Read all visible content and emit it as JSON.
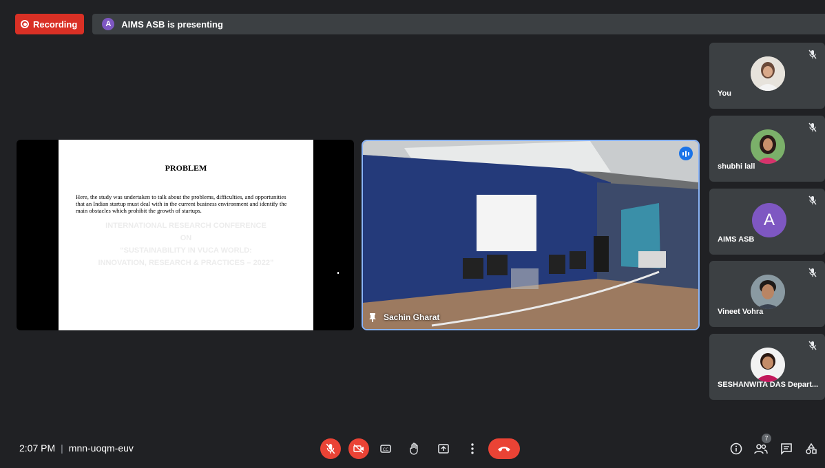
{
  "recording": {
    "label": "Recording"
  },
  "presentation_banner": {
    "avatar_letter": "A",
    "text": "AIMS ASB is presenting"
  },
  "slide": {
    "title": "PROBLEM",
    "body": "Here, the study was undertaken to talk about the problems, difficulties, and opportunities that an Indian startup must deal with in the current business environment and identify the main obstacles which prohibit the growth of startups.",
    "watermark": [
      "INTERNATIONAL RESEARCH CONFERENCE",
      "ON",
      "“SUSTAINABILITY IN VUCA WORLD:",
      "INNOVATION, RESEARCH & PRACTICES – 2022”"
    ]
  },
  "active_speaker": {
    "name": "Sachin Gharat"
  },
  "participants": [
    {
      "name": "You",
      "avatar": "photo",
      "muted": true
    },
    {
      "name": "shubhi lall",
      "avatar": "photo",
      "muted": true
    },
    {
      "name": "AIMS ASB",
      "avatar_letter": "A",
      "muted": true
    },
    {
      "name": "Vineet Vohra",
      "avatar": "photo",
      "muted": true
    },
    {
      "name": "SESHANWITA DAS Depart...",
      "avatar": "photo",
      "muted": true
    }
  ],
  "meeting": {
    "time": "2:07 PM",
    "separator": "|",
    "code": "mnn-uoqm-euv"
  },
  "people_count": "7",
  "colors": {
    "background": "#202124",
    "tile": "#3c4043",
    "accent_red": "#ea4335",
    "speaker_border": "#8ab4f8"
  }
}
